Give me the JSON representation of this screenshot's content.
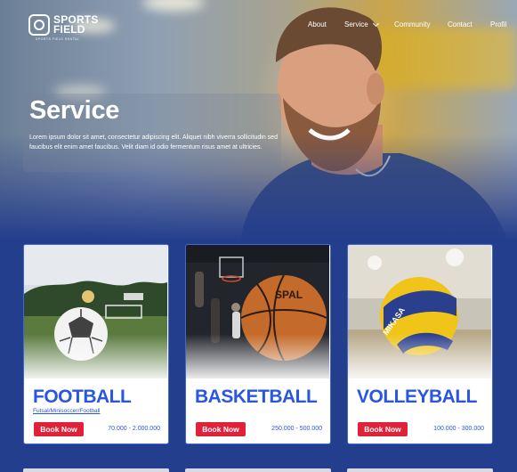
{
  "brand": {
    "name_line1": "SPORTS",
    "name_line2": "FIELD",
    "tagline": "SPORTS FIELD RENTAL"
  },
  "nav": {
    "about": "About",
    "service": "Service",
    "community": "Community",
    "contact": "Contact",
    "profile": "Profil"
  },
  "hero": {
    "title": "Service",
    "description": "Lorem ipsum dolor sit amet, consectetur adipiscing elit. Aliquet nibh viverra sollicitudin sed faucibus elit enim amet faucibus. Velit diam id odio fermentum risus amet at ultricies."
  },
  "cards": [
    {
      "title": "FOOTBALL",
      "subtitle": "Futsal/Minisoccer/Football",
      "button": "Book Now",
      "price": "70.000 - 2.000.000"
    },
    {
      "title": "BASKETBALL",
      "subtitle": "",
      "button": "Book Now",
      "price": "250.000 - 500.000"
    },
    {
      "title": "VOLLEYBALL",
      "subtitle": "",
      "button": "Book Now",
      "price": "100.000 - 300.000"
    }
  ],
  "colors": {
    "primary_blue": "#2a56e0",
    "background": "#243e8e",
    "button_red": "#e0213a"
  }
}
